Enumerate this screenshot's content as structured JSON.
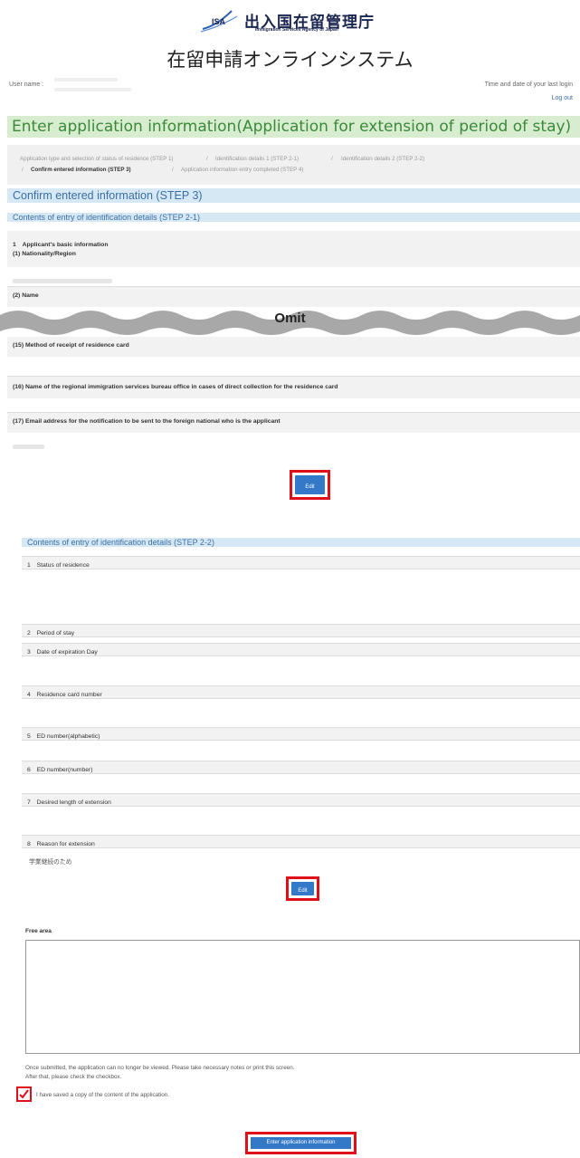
{
  "header": {
    "logo_short": "ISA",
    "logo_title": "出入国在留管理庁",
    "logo_subtitle": "Immigration Services Agency of Japan",
    "system_title": "在留申請オンラインシステム",
    "user_name_label": "User name :",
    "last_login_label": "Time and date of your last login",
    "logout": "Log out"
  },
  "main_title": "Enter application information(Application for extension of period of stay)",
  "breadcrumb": [
    "Application type and selection of status of residence (STEP 1)",
    "/",
    "Identification details 1 (STEP 2-1)",
    "/",
    "Identification details 2 (STEP 2-2)",
    "/",
    "Confirm entered information (STEP 3)",
    "/",
    "Application information entry completed (STEP 4)"
  ],
  "confirm_title": "Confirm entered information (STEP 3)",
  "step21": {
    "title": "Contents of entry of identification details (STEP 2-1)",
    "section_heading": "1　Applicant's basic information",
    "nationality": "(1) Nationality/Region",
    "name": "(2) Name",
    "omit": "Omit",
    "receipt_method": "(15) Method of receipt of residence card",
    "office_name": "(16) Name of the regional immigration services bureau office in cases of direct collection for the residence card",
    "email": "(17) Email address for the notification to be sent to the foreign national who is the applicant",
    "edit": "Edit"
  },
  "step22": {
    "title": "Contents of entry of identification details (STEP 2-2)",
    "items": [
      "1　Status of residence",
      "2　Period of stay",
      "3　Date of expiration Day",
      "4　Residence card number",
      "5　ED number(alphabetic)",
      "6　ED number(number)",
      "7　Desired length of extension",
      "8　Reason for extension"
    ],
    "reason_value": "学業継続のため",
    "edit": "Edit"
  },
  "free_area": {
    "label": "Free area",
    "value": ""
  },
  "notice_line1": "Once submitted, the application can no longer be viewed. Please take necessary notes or print this screen.",
  "notice_line2": "After that, please check the checkbox.",
  "checkbox": {
    "checked": true,
    "label": "I have saved a copy of the content of the application."
  },
  "submit_button": "Enter application information",
  "colors": {
    "title_bar": "#d8eccf",
    "title_text": "#3a8a3a",
    "section_bar": "#d6e8f4",
    "section_text": "#3a6fa6",
    "button": "#3478c8",
    "highlight": "#e0101a"
  }
}
